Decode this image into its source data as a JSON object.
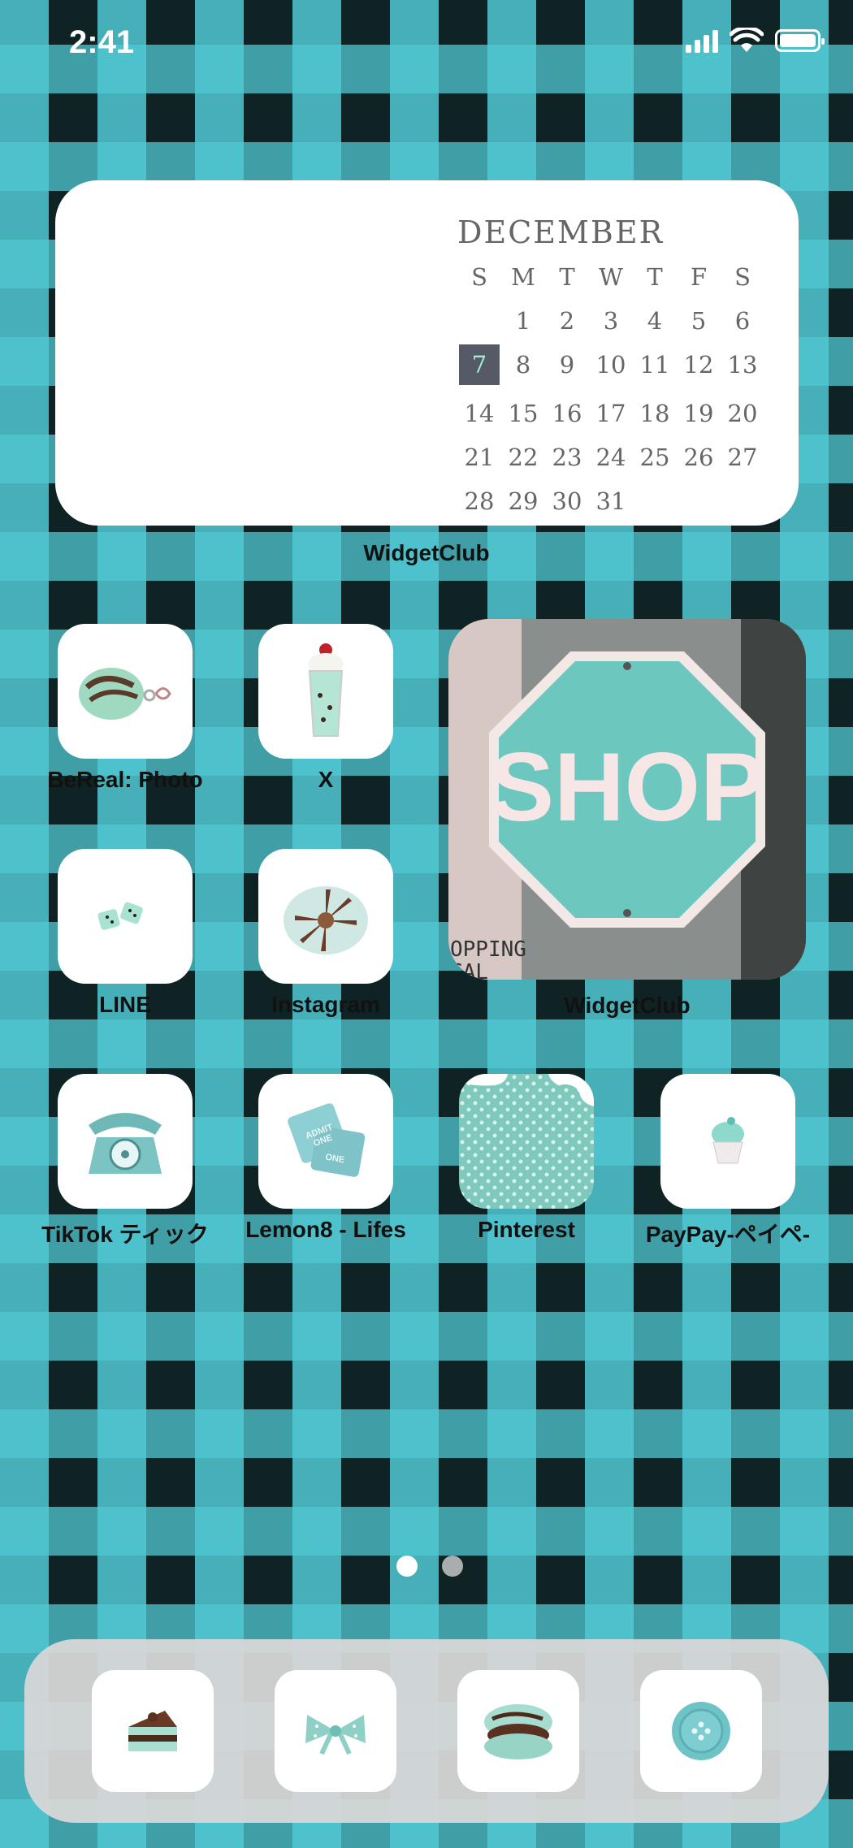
{
  "status_bar": {
    "time": "2:41",
    "icons": [
      "cellular-signal-icon",
      "wifi-icon",
      "battery-icon"
    ]
  },
  "calendar_widget": {
    "month": "DECEMBER",
    "weekdays": [
      "S",
      "M",
      "T",
      "W",
      "T",
      "F",
      "S"
    ],
    "leading_blanks": 1,
    "days": [
      "1",
      "2",
      "3",
      "4",
      "5",
      "6",
      "7",
      "8",
      "9",
      "10",
      "11",
      "12",
      "13",
      "14",
      "15",
      "16",
      "17",
      "18",
      "19",
      "20",
      "21",
      "22",
      "23",
      "24",
      "25",
      "26",
      "27",
      "28",
      "29",
      "30",
      "31"
    ],
    "today": "7",
    "label": "WidgetClub"
  },
  "apps": [
    {
      "label": "BeReal: Photo",
      "icon": "mint-chocolate-bun-keychain-icon"
    },
    {
      "label": "X",
      "icon": "mint-milkshake-icon"
    },
    {
      "label": "LINE",
      "icon": "mint-dice-icon"
    },
    {
      "label": "Instagram",
      "icon": "mint-chocolate-cake-icon"
    },
    {
      "label": "TikTok ティック",
      "icon": "mint-rotary-phone-icon"
    },
    {
      "label": "Lemon8 - Lifes",
      "icon": "admit-one-tickets-icon"
    },
    {
      "label": "Pinterest",
      "icon": "polka-dot-cloud-icon"
    },
    {
      "label": "PayPay-ペイペ-",
      "icon": "mint-cupcake-icon"
    }
  ],
  "photo_widget": {
    "sign_text": "SHOP",
    "background_text": "OPPING\nCAL",
    "label": "WidgetClub"
  },
  "page_dots": {
    "count": 2,
    "active": 0
  },
  "dock": [
    {
      "icon": "mint-layer-cake-icon"
    },
    {
      "icon": "mint-bow-icon"
    },
    {
      "icon": "mint-macaron-icon"
    },
    {
      "icon": "mint-button-icon"
    }
  ],
  "colors": {
    "accent": "#6cc7bf",
    "today_bg": "#555a66",
    "today_text": "#9ef0d0"
  }
}
